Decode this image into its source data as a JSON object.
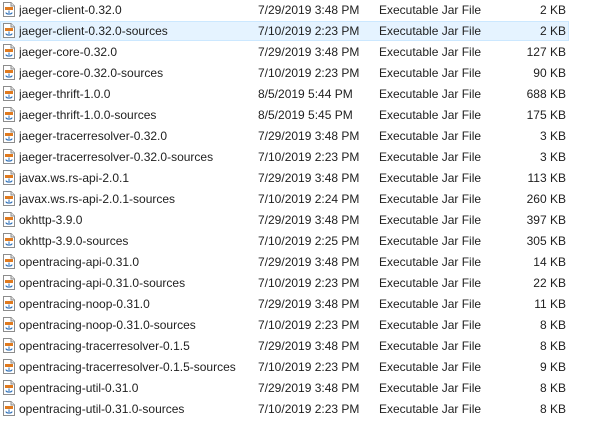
{
  "file_list": {
    "selected_index": 1,
    "icon": "executable-jar-file-icon",
    "rows": [
      {
        "name": "jaeger-client-0.32.0",
        "date": "7/29/2019 3:48 PM",
        "type": "Executable Jar File",
        "size": "2 KB"
      },
      {
        "name": "jaeger-client-0.32.0-sources",
        "date": "7/10/2019 2:23 PM",
        "type": "Executable Jar File",
        "size": "2 KB"
      },
      {
        "name": "jaeger-core-0.32.0",
        "date": "7/29/2019 3:48 PM",
        "type": "Executable Jar File",
        "size": "127 KB"
      },
      {
        "name": "jaeger-core-0.32.0-sources",
        "date": "7/10/2019 2:23 PM",
        "type": "Executable Jar File",
        "size": "90 KB"
      },
      {
        "name": "jaeger-thrift-1.0.0",
        "date": "8/5/2019 5:44 PM",
        "type": "Executable Jar File",
        "size": "688 KB"
      },
      {
        "name": "jaeger-thrift-1.0.0-sources",
        "date": "8/5/2019 5:45 PM",
        "type": "Executable Jar File",
        "size": "175 KB"
      },
      {
        "name": "jaeger-tracerresolver-0.32.0",
        "date": "7/29/2019 3:48 PM",
        "type": "Executable Jar File",
        "size": "3 KB"
      },
      {
        "name": "jaeger-tracerresolver-0.32.0-sources",
        "date": "7/10/2019 2:23 PM",
        "type": "Executable Jar File",
        "size": "3 KB"
      },
      {
        "name": "javax.ws.rs-api-2.0.1",
        "date": "7/29/2019 3:48 PM",
        "type": "Executable Jar File",
        "size": "113 KB"
      },
      {
        "name": "javax.ws.rs-api-2.0.1-sources",
        "date": "7/10/2019 2:24 PM",
        "type": "Executable Jar File",
        "size": "260 KB"
      },
      {
        "name": "okhttp-3.9.0",
        "date": "7/29/2019 3:48 PM",
        "type": "Executable Jar File",
        "size": "397 KB"
      },
      {
        "name": "okhttp-3.9.0-sources",
        "date": "7/10/2019 2:25 PM",
        "type": "Executable Jar File",
        "size": "305 KB"
      },
      {
        "name": "opentracing-api-0.31.0",
        "date": "7/29/2019 3:48 PM",
        "type": "Executable Jar File",
        "size": "14 KB"
      },
      {
        "name": "opentracing-api-0.31.0-sources",
        "date": "7/10/2019 2:23 PM",
        "type": "Executable Jar File",
        "size": "22 KB"
      },
      {
        "name": "opentracing-noop-0.31.0",
        "date": "7/29/2019 3:48 PM",
        "type": "Executable Jar File",
        "size": "11 KB"
      },
      {
        "name": "opentracing-noop-0.31.0-sources",
        "date": "7/10/2019 2:23 PM",
        "type": "Executable Jar File",
        "size": "8 KB"
      },
      {
        "name": "opentracing-tracerresolver-0.1.5",
        "date": "7/29/2019 3:48 PM",
        "type": "Executable Jar File",
        "size": "8 KB"
      },
      {
        "name": "opentracing-tracerresolver-0.1.5-sources",
        "date": "7/10/2019 2:23 PM",
        "type": "Executable Jar File",
        "size": "9 KB"
      },
      {
        "name": "opentracing-util-0.31.0",
        "date": "7/29/2019 3:48 PM",
        "type": "Executable Jar File",
        "size": "8 KB"
      },
      {
        "name": "opentracing-util-0.31.0-sources",
        "date": "7/10/2019 2:23 PM",
        "type": "Executable Jar File",
        "size": "8 KB"
      }
    ]
  }
}
